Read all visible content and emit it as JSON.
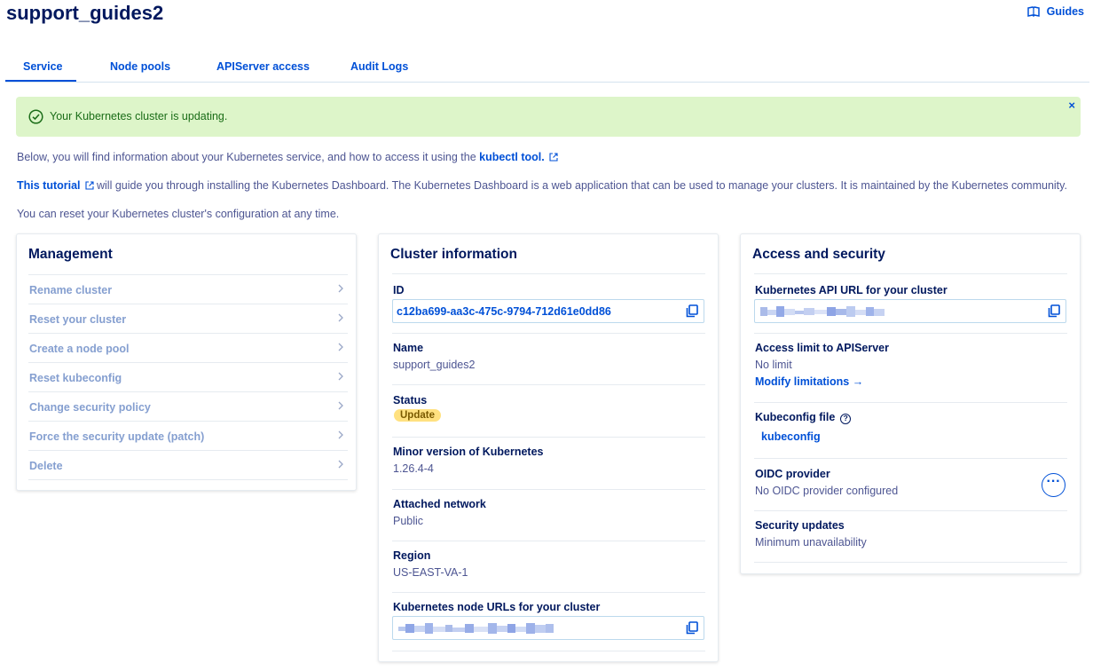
{
  "header": {
    "title": "support_guides2",
    "guides_label": "Guides"
  },
  "tabs": [
    {
      "label": "Service"
    },
    {
      "label": "Node pools"
    },
    {
      "label": "APIServer access"
    },
    {
      "label": "Audit Logs"
    }
  ],
  "alert": {
    "message": "Your Kubernetes cluster is updating.",
    "close": "×"
  },
  "intro": {
    "line1_text": "Below, you will find information about your Kubernetes service, and how to access it using the ",
    "line1_link": "kubectl tool.",
    "line2_link": "This tutorial",
    "line2_text": " will guide you through installing the Kubernetes Dashboard. The Kubernetes Dashboard is a web application that can be used to manage your clusters. It is maintained by the Kubernetes community.",
    "line3_text": "You can reset your Kubernetes cluster's configuration at any time."
  },
  "management": {
    "title": "Management",
    "items": [
      {
        "label": "Rename cluster"
      },
      {
        "label": "Reset your cluster"
      },
      {
        "label": "Create a node pool"
      },
      {
        "label": "Reset kubeconfig"
      },
      {
        "label": "Change security policy"
      },
      {
        "label": "Force the security update (patch)"
      },
      {
        "label": "Delete"
      }
    ]
  },
  "cluster_info": {
    "title": "Cluster information",
    "id_label": "ID",
    "id_value": "c12ba699-aa3c-475c-9794-712d61e0dd86",
    "name_label": "Name",
    "name_value": "support_guides2",
    "status_label": "Status",
    "status_value": "Update",
    "version_label": "Minor version of Kubernetes",
    "version_value": "1.26.4-4",
    "network_label": "Attached network",
    "network_value": "Public",
    "region_label": "Region",
    "region_value": "US-EAST-VA-1",
    "node_urls_label": "Kubernetes node URLs for your cluster"
  },
  "access": {
    "title": "Access and security",
    "api_url_label": "Kubernetes API URL for your cluster",
    "limit_label": "Access limit to APIServer",
    "limit_value": "No limit",
    "modify_link": "Modify limitations →",
    "kubeconfig_label": "Kubeconfig file",
    "kubeconfig_help": "?",
    "kubeconfig_link": "kubeconfig",
    "oidc_label": "OIDC provider",
    "oidc_value": "No OIDC provider configured",
    "oidc_menu": "···",
    "security_label": "Security updates",
    "security_value": "Minimum unavailability"
  },
  "colors": {
    "primary": "#0050d7",
    "heading": "#00185e",
    "success_bg": "#ddf5c9",
    "badge_bg": "#ffe180"
  }
}
